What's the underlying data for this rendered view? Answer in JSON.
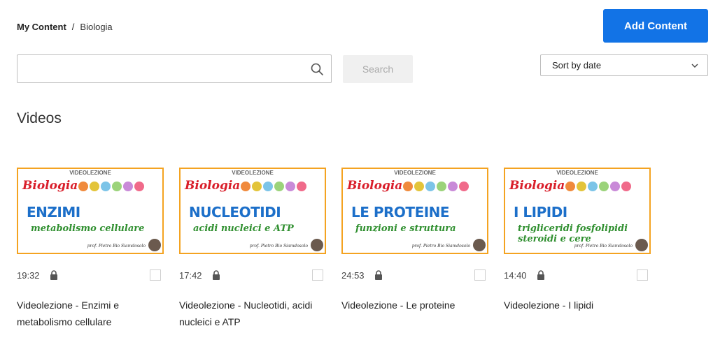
{
  "breadcrumb": {
    "root": "My Content",
    "separator": "/",
    "current": "Biologia"
  },
  "toolbar": {
    "add_label": "Add Content",
    "search_label": "Search",
    "search_placeholder": "",
    "sort_label": "Sort by date"
  },
  "section": {
    "title": "Videos"
  },
  "videos": [
    {
      "duration": "19:32",
      "title": "Videolezione - Enzimi e metabolismo cellulare",
      "thumb_header": "VIDEOLEZIONE",
      "thumb_subject": "Biologia",
      "thumb_main": "ENZIMI",
      "thumb_sub": "metabolismo cellulare",
      "thumb_prof": "prof. Pietro Bio Siamdosolo"
    },
    {
      "duration": "17:42",
      "title": "Videolezione - Nucleotidi, acidi nucleici e ATP",
      "thumb_header": "VIDEOLEZIONE",
      "thumb_subject": "Biologia",
      "thumb_main": "NUCLEOTIDI",
      "thumb_sub": "acidi nucleici e ATP",
      "thumb_prof": "prof. Pietro Bio Siamdosolo"
    },
    {
      "duration": "24:53",
      "title": "Videolezione - Le proteine",
      "thumb_header": "VIDEOLEZIONE",
      "thumb_subject": "Biologia",
      "thumb_main": "LE PROTEINE",
      "thumb_sub": "funzioni e struttura",
      "thumb_prof": "prof. Pietro Bio Siamdosolo"
    },
    {
      "duration": "14:40",
      "title": "Videolezione - I lipidi",
      "thumb_header": "VIDEOLEZIONE",
      "thumb_subject": "Biologia",
      "thumb_main": "I LIPIDI",
      "thumb_sub": "trigliceridi fosfolipidi steroidi e cere",
      "thumb_prof": "prof. Pietro Bio Siamdosolo"
    }
  ],
  "colors": {
    "primary": "#1273e6",
    "thumb_border": "#f4a321",
    "subject_red": "#d91e2a",
    "main_blue": "#1c6fc9",
    "sub_green": "#2f8f2f"
  },
  "icons": {
    "search": "search-icon",
    "sort": "chevron-down-icon",
    "lock": "lock-icon"
  }
}
